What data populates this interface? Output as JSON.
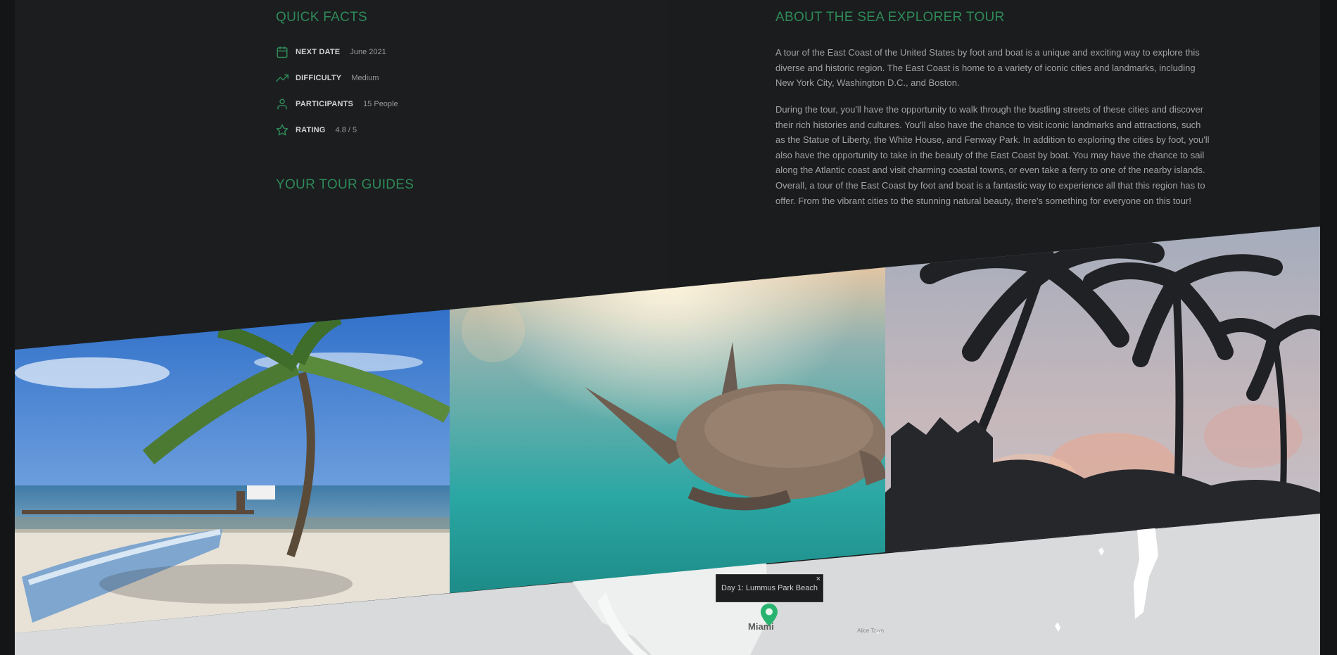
{
  "quick_facts": {
    "heading": "QUICK FACTS",
    "items": [
      {
        "icon": "calendar-icon",
        "label": "NEXT DATE",
        "value": "June 2021"
      },
      {
        "icon": "trending-up-icon",
        "label": "DIFFICULTY",
        "value": "Medium"
      },
      {
        "icon": "user-icon",
        "label": "PARTICIPANTS",
        "value": "15 People"
      },
      {
        "icon": "star-icon",
        "label": "RATING",
        "value": "4.8 / 5"
      }
    ]
  },
  "guides": {
    "heading": "YOUR TOUR GUIDES"
  },
  "about": {
    "heading": "ABOUT THE SEA EXPLORER TOUR",
    "paragraphs": [
      "A tour of the East Coast of the United States by foot and boat is a unique and exciting way to explore this diverse and historic region. The East Coast is home to a variety of iconic cities and landmarks, including New York City, Washington D.C., and Boston.",
      "During the tour, you'll have the opportunity to walk through the bustling streets of these cities and discover their rich histories and cultures. You'll also have the chance to visit iconic landmarks and attractions, such as the Statue of Liberty, the White House, and Fenway Park. In addition to exploring the cities by foot, you'll also have the opportunity to take in the beauty of the East Coast by boat. You may have the chance to sail along the Atlantic coast and visit charming coastal towns, or even take a ferry to one of the nearby islands. Overall, a tour of the East Coast by foot and boat is a fantastic way to experience all that this region has to offer. From the vibrant cities to the stunning natural beauty, there's something for everyone on this tour!"
    ]
  },
  "gallery": {
    "images": [
      "beach-palm-boat-photo",
      "sea-turtle-photo",
      "palm-silhouettes-photo"
    ]
  },
  "map": {
    "popup_text": "Day 1: Lummus Park Beach",
    "close_symbol": "×",
    "city_label": "Miami",
    "small_place_label": "Alice Town",
    "marker_color": "#28b46f"
  },
  "colors": {
    "accent": "#2f8a58",
    "marker": "#28b46f",
    "background": "#1b1d1f"
  }
}
